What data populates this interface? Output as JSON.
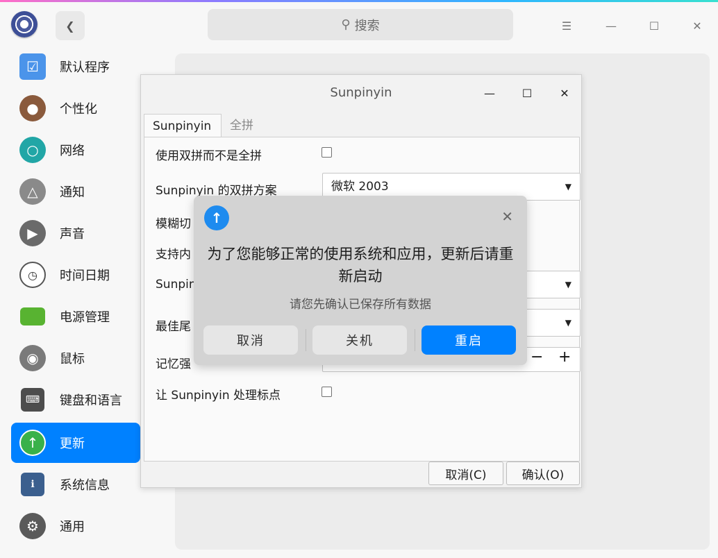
{
  "titlebar": {
    "search_placeholder": "搜索"
  },
  "sidebar": {
    "items": [
      {
        "label": "默认程序",
        "icon": "default-apps-icon",
        "color": "#3a8de8"
      },
      {
        "label": "个性化",
        "icon": "palette-icon",
        "color": "#8a5a3c"
      },
      {
        "label": "网络",
        "icon": "globe-icon",
        "color": "#21a6a6"
      },
      {
        "label": "通知",
        "icon": "bell-icon",
        "color": "#8a8a8a"
      },
      {
        "label": "声音",
        "icon": "speaker-icon",
        "color": "#6a6a6a"
      },
      {
        "label": "时间日期",
        "icon": "clock-icon",
        "color": "#e8e8e8"
      },
      {
        "label": "电源管理",
        "icon": "battery-icon",
        "color": "#58b331"
      },
      {
        "label": "鼠标",
        "icon": "mouse-icon",
        "color": "#7a7a7a"
      },
      {
        "label": "键盘和语言",
        "icon": "keyboard-icon",
        "color": "#4d4d4d"
      },
      {
        "label": "更新",
        "icon": "update-arrow-icon",
        "color": "#39b14a",
        "active": true
      },
      {
        "label": "系统信息",
        "icon": "system-info-icon",
        "color": "#3b5f8e"
      },
      {
        "label": "通用",
        "icon": "general-gear-icon",
        "color": "#5a5a5a"
      }
    ]
  },
  "sunpinyin": {
    "title": "Sunpinyin",
    "tabs": [
      "Sunpinyin",
      "全拼"
    ],
    "rows": {
      "shuangpin": "使用双拼而不是全拼",
      "scheme_label": "Sunpinyin 的双拼方案",
      "scheme_value": "微软 2003",
      "fuzzy": "模糊切",
      "support": "支持内",
      "sunpin": "Sunpin",
      "best": "最佳尾",
      "memory": "记忆强",
      "punct": "让 Sunpinyin 处理标点"
    },
    "buttons": {
      "cancel": "取消(C)",
      "ok": "确认(O)"
    }
  },
  "dialog": {
    "title": "为了您能够正常的使用系统和应用，更新后请重新启动",
    "subtitle": "请您先确认已保存所有数据",
    "buttons": {
      "cancel": "取消",
      "shutdown": "关机",
      "restart": "重启"
    }
  }
}
